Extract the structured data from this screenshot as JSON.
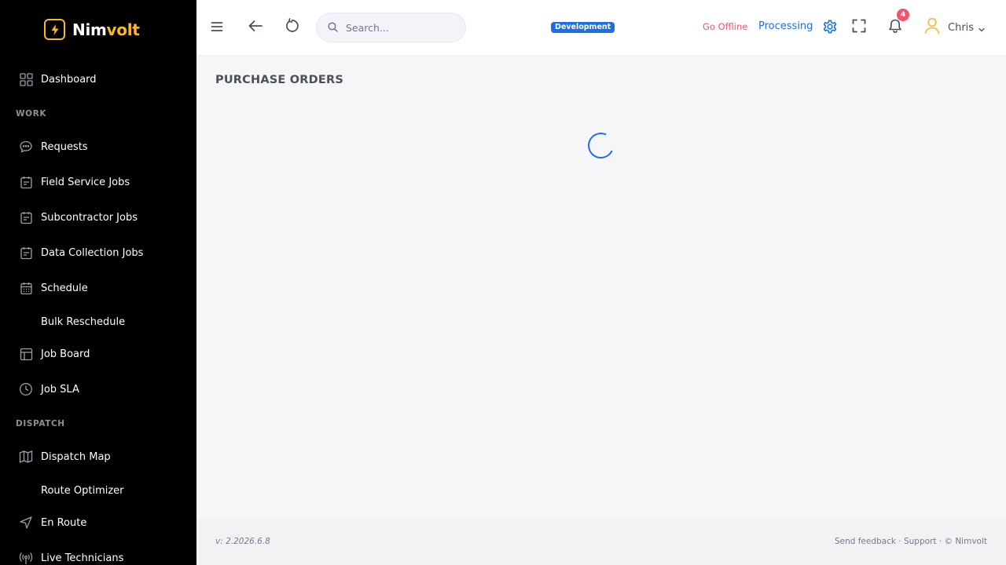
{
  "app": {
    "brand_part1": "Nim",
    "brand_part2": "volt"
  },
  "sidebar": {
    "items": [
      {
        "label": "Dashboard",
        "icon": "grid-icon"
      },
      {
        "section": "WORK"
      },
      {
        "label": "Requests",
        "icon": "chat-bubble-icon"
      },
      {
        "label": "Field Service Jobs",
        "icon": "clipboard-icon"
      },
      {
        "label": "Subcontractor Jobs",
        "icon": "clipboard-icon"
      },
      {
        "label": "Data Collection Jobs",
        "icon": "clipboard-icon"
      },
      {
        "label": "Schedule",
        "icon": "calendar-icon"
      },
      {
        "label": "Bulk Reschedule"
      },
      {
        "label": "Job Board",
        "icon": "board-layout-icon"
      },
      {
        "label": "Job SLA",
        "icon": "clock-icon"
      },
      {
        "section": "DISPATCH"
      },
      {
        "label": "Dispatch Map",
        "icon": "map-icon"
      },
      {
        "label": "Route Optimizer"
      },
      {
        "label": "En Route",
        "icon": "navigation-arrow-icon"
      },
      {
        "label": "Live Technicians",
        "icon": "broadcast-icon"
      }
    ]
  },
  "topbar": {
    "search_placeholder": "Search...",
    "environment": "Development",
    "go_offline": "Go Offline",
    "processing": "Processing",
    "notification_count": "4",
    "user_name": "Chris"
  },
  "main": {
    "page_title": "PURCHASE ORDERS"
  },
  "footer": {
    "version": "v: 2.2026.6.8",
    "links": "Send feedback · Support · © Nimvolt"
  },
  "colors": {
    "sidebar_bg": "#000000",
    "brand_accent": "#f7b731",
    "primary": "#1c6fe8",
    "danger": "#f1556c"
  }
}
